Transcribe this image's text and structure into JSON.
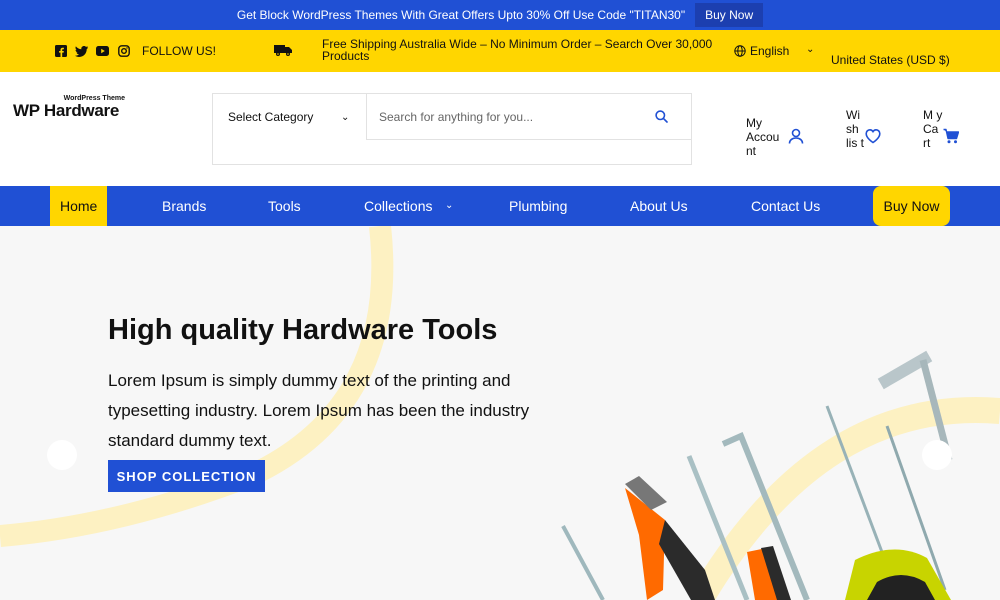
{
  "promo": {
    "text": "Get Block WordPress Themes With Great Offers Upto 30% Off Use Code \"TITAN30\"",
    "button": "Buy Now"
  },
  "topbar": {
    "follow": "FOLLOW US!",
    "shipping": "Free Shipping Australia Wide – No Minimum Order – Search Over 30,000 Products",
    "language": "English",
    "currency": "United States (USD $)"
  },
  "logo": {
    "small": "WordPress Theme",
    "main": "WP Hardware"
  },
  "search": {
    "category": "Select Category",
    "placeholder": "Search for anything for you..."
  },
  "account": {
    "my_account": "My Accou nt",
    "wishlist": "Wi sh lis t",
    "cart": "M y Ca rt"
  },
  "nav": {
    "home": "Home",
    "brands": "Brands",
    "tools": "Tools",
    "collections": "Collections",
    "plumbing": "Plumbing",
    "about": "About Us",
    "contact": "Contact Us",
    "buy": "Buy Now"
  },
  "hero": {
    "title": "High quality Hardware Tools",
    "text": "Lorem Ipsum is simply dummy text of the printing and typesetting industry. Lorem Ipsum has been the industry standard dummy text.",
    "button": "SHOP COLLECTION"
  },
  "colors": {
    "primary": "#2050d4",
    "accent": "#ffd600"
  }
}
